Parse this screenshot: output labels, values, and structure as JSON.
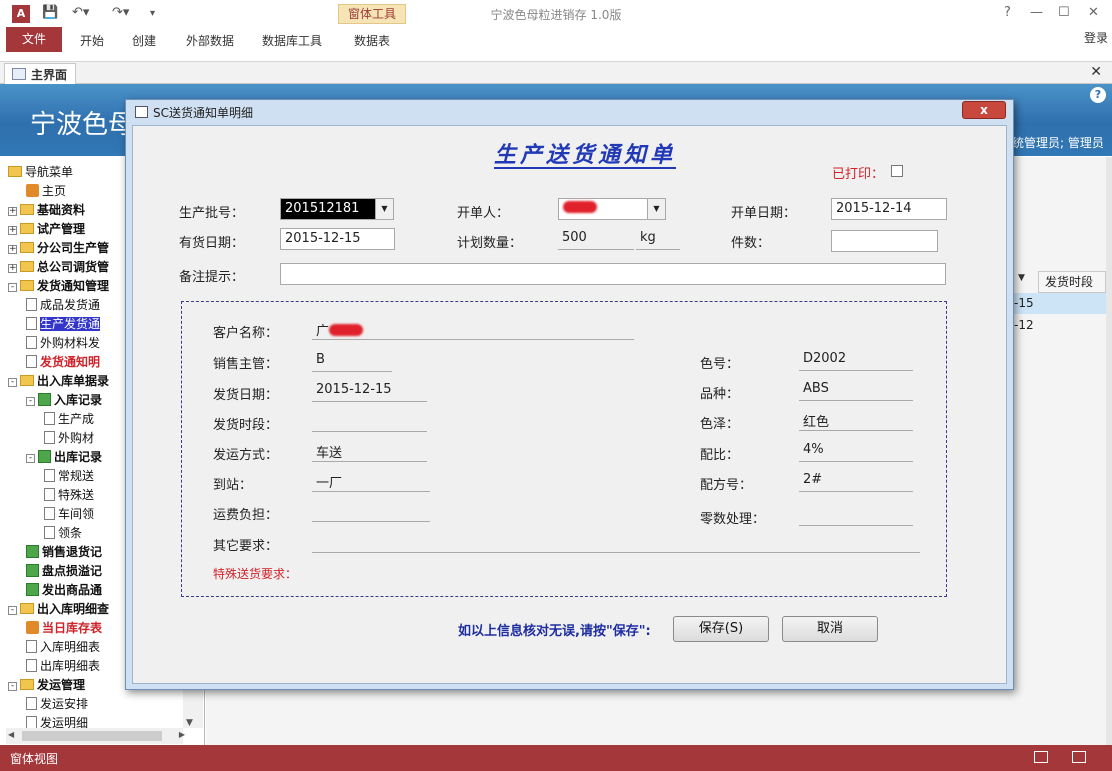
{
  "window": {
    "title": "宁波色母粒进销存 1.0版",
    "app_icon": "A",
    "context_group": "窗体工具",
    "login": "登录",
    "controls": [
      "?",
      "—",
      "☐",
      "✕"
    ]
  },
  "ribbon": {
    "tabs": [
      "文件",
      "开始",
      "创建",
      "外部数据",
      "数据库工具",
      "数据表"
    ]
  },
  "doc_tab": {
    "label": "主界面"
  },
  "header": {
    "title": "宁波色母",
    "user_text": "统管理员; 管理员"
  },
  "nav": {
    "items": [
      {
        "label": "导航菜单",
        "level": 0,
        "icon": "folder-icon",
        "toggle": ""
      },
      {
        "label": "主页",
        "level": 1,
        "icon": "home-icon",
        "toggle": ""
      },
      {
        "label": "基础资料",
        "level": 0,
        "icon": "folder-icon",
        "toggle": "+",
        "bold": true
      },
      {
        "label": "试产管理",
        "level": 0,
        "icon": "folder-icon",
        "toggle": "+",
        "bold": true
      },
      {
        "label": "分公司生产管",
        "level": 0,
        "icon": "folder-icon",
        "toggle": "+",
        "bold": true
      },
      {
        "label": "总公司调货管",
        "level": 0,
        "icon": "folder-icon",
        "toggle": "+",
        "bold": true
      },
      {
        "label": "发货通知管理",
        "level": 0,
        "icon": "folder-icon",
        "toggle": "-",
        "bold": true
      },
      {
        "label": "成品发货通",
        "level": 1,
        "icon": "document-icon"
      },
      {
        "label": "生产发货通",
        "level": 1,
        "icon": "document-icon",
        "selected": true
      },
      {
        "label": "外购材料发",
        "level": 1,
        "icon": "document-icon"
      },
      {
        "label": "发货通知明",
        "level": 1,
        "icon": "document-icon",
        "red": true
      },
      {
        "label": "出入库单据录",
        "level": 0,
        "icon": "folder-icon",
        "toggle": "-",
        "bold": true
      },
      {
        "label": "入库记录",
        "level": 1,
        "icon": "book-icon",
        "toggle": "-",
        "bold": true
      },
      {
        "label": "生产成",
        "level": 2,
        "icon": "document-icon"
      },
      {
        "label": "外购材",
        "level": 2,
        "icon": "document-icon"
      },
      {
        "label": "出库记录",
        "level": 1,
        "icon": "book-icon",
        "toggle": "-",
        "bold": true
      },
      {
        "label": "常规送",
        "level": 2,
        "icon": "document-icon"
      },
      {
        "label": "特殊送",
        "level": 2,
        "icon": "document-icon"
      },
      {
        "label": "车间领",
        "level": 2,
        "icon": "document-icon"
      },
      {
        "label": "领条",
        "level": 2,
        "icon": "document-icon"
      },
      {
        "label": "销售退货记",
        "level": 1,
        "icon": "book-icon",
        "bold": true
      },
      {
        "label": "盘点损溢记",
        "level": 1,
        "icon": "book-icon",
        "bold": true
      },
      {
        "label": "发出商品通",
        "level": 1,
        "icon": "book-icon",
        "bold": true
      },
      {
        "label": "出入库明细查",
        "level": 0,
        "icon": "folder-icon",
        "toggle": "-",
        "bold": true
      },
      {
        "label": "当日库存表",
        "level": 1,
        "icon": "home-icon",
        "red": true
      },
      {
        "label": "入库明细表",
        "level": 1,
        "icon": "document-icon"
      },
      {
        "label": "出库明细表",
        "level": 1,
        "icon": "document-icon"
      },
      {
        "label": "发运管理",
        "level": 0,
        "icon": "folder-icon",
        "toggle": "-",
        "bold": true
      },
      {
        "label": "发运安排",
        "level": 1,
        "icon": "document-icon"
      },
      {
        "label": "发运明细",
        "level": 1,
        "icon": "document-icon"
      }
    ]
  },
  "background_grid": {
    "column_header": "发货时段",
    "rows": [
      "-15",
      "-12"
    ]
  },
  "status": {
    "text": "窗体视图"
  },
  "dialog": {
    "title": "SC送货通知单明细",
    "heading": "生产送货通知单",
    "printed_label": "已打印：",
    "printed": false,
    "batch_label": "生产批号：",
    "batch_value": "201512181",
    "issuer_label": "开单人：",
    "date_label": "开单日期：",
    "date_value": "2015-12-14",
    "stock_date_label": "有货日期：",
    "stock_date_value": "2015-12-15",
    "qty_label": "计划数量：",
    "qty_value": "500",
    "qty_unit": "kg",
    "pieces_label": "件数：",
    "pieces_value": "",
    "remark_label": "备注提示：",
    "remark_value": "",
    "customer_label": "客户名称：",
    "customer_value": "广",
    "sales_label": "销售主管：",
    "sales_value": "B",
    "ship_date_label": "发货日期：",
    "ship_date_value": "2015-12-15",
    "period_label": "发货时段：",
    "period_value": "",
    "method_label": "发运方式：",
    "method_value": "车送",
    "station_label": "到站：",
    "station_value": "一厂",
    "freight_label": "运费负担：",
    "freight_value": "",
    "other_label": "其它要求：",
    "other_value": "",
    "special_label": "特殊送货要求：",
    "color_no_label": "色号：",
    "color_no_value": "D2002",
    "variety_label": "品种：",
    "variety_value": "ABS",
    "color_label": "色泽：",
    "color_value": "红色",
    "ratio_label": "配比：",
    "ratio_value": "4%",
    "recipe_label": "配方号：",
    "recipe_value": "2#",
    "fraction_label": "零数处理：",
    "fraction_value": "",
    "confirm_text": "如以上信息核对无误,请按\"保存\":",
    "save_label": "保存(S)",
    "cancel_label": "取消",
    "close_glyph": "x"
  },
  "colors": {
    "accent": "#a4373a",
    "header_blue": "#2f6fae",
    "heading_blue": "#2239b5",
    "red": "#d0232a"
  }
}
